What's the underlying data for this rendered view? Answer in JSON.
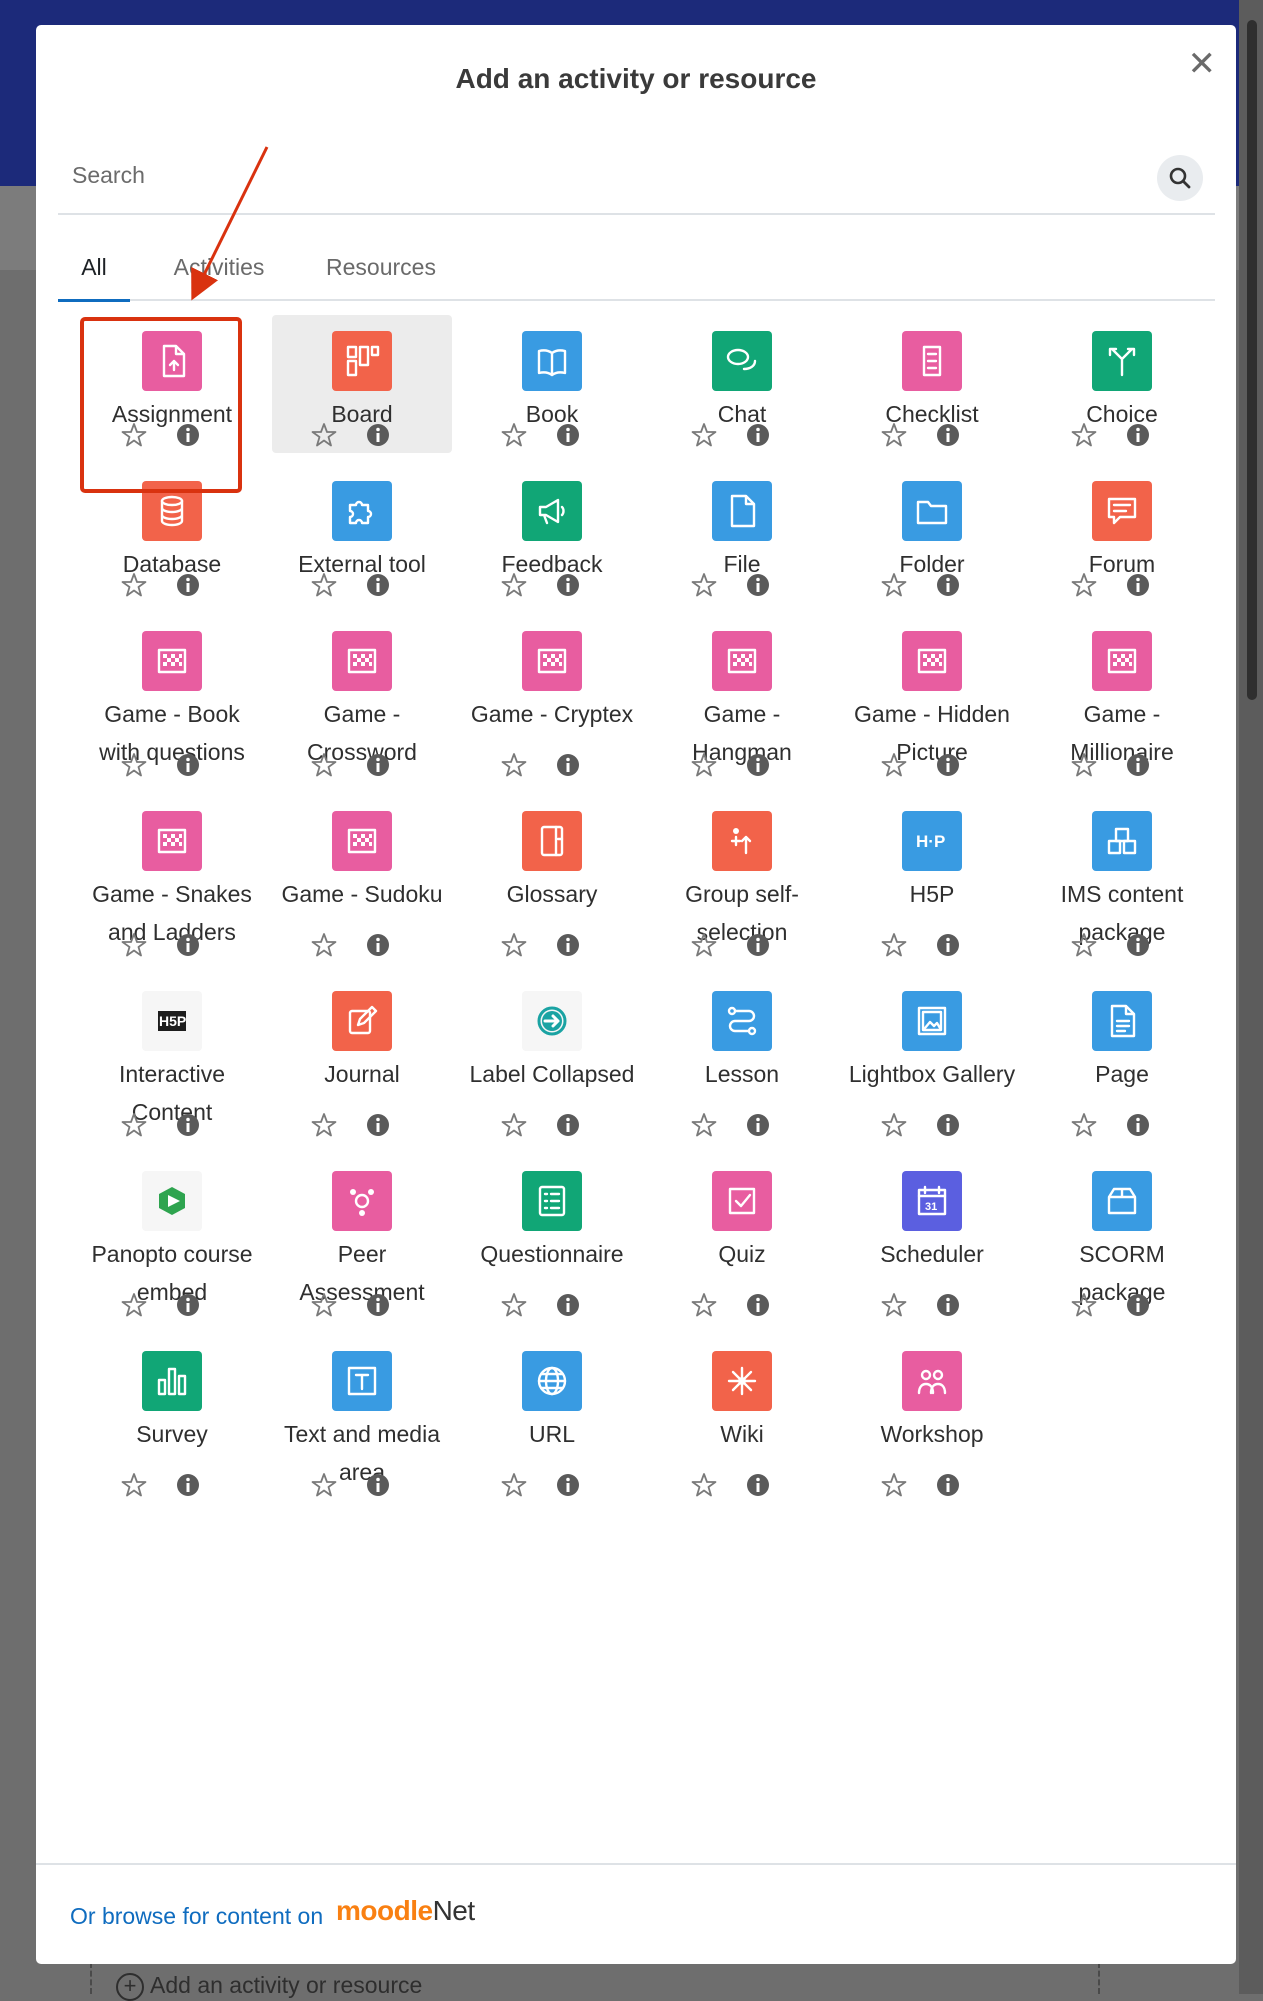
{
  "background": {
    "footer_link": "Add an activity or resource"
  },
  "modal": {
    "title": "Add an activity or resource",
    "close_icon": "close-icon",
    "search": {
      "placeholder": "Search",
      "value": ""
    },
    "tabs": [
      {
        "label": "All",
        "active": true
      },
      {
        "label": "Activities",
        "active": false
      },
      {
        "label": "Resources",
        "active": false
      }
    ],
    "items": [
      {
        "label": "Assignment",
        "icon": "assignment-icon",
        "color": "#e85da0"
      },
      {
        "label": "Board",
        "icon": "board-icon",
        "color": "#f2634a"
      },
      {
        "label": "Book",
        "icon": "book-icon",
        "color": "#399be2"
      },
      {
        "label": "Chat",
        "icon": "chat-icon",
        "color": "#11a676"
      },
      {
        "label": "Checklist",
        "icon": "checklist-icon",
        "color": "#e85da0"
      },
      {
        "label": "Choice",
        "icon": "choice-icon",
        "color": "#11a676"
      },
      {
        "label": "Database",
        "icon": "database-icon",
        "color": "#f2634a"
      },
      {
        "label": "External tool",
        "icon": "puzzle-icon",
        "color": "#399be2"
      },
      {
        "label": "Feedback",
        "icon": "megaphone-icon",
        "color": "#11a676"
      },
      {
        "label": "File",
        "icon": "file-icon",
        "color": "#399be2"
      },
      {
        "label": "Folder",
        "icon": "folder-icon",
        "color": "#399be2"
      },
      {
        "label": "Forum",
        "icon": "forum-icon",
        "color": "#f2634a"
      },
      {
        "label": "Game - Book with questions",
        "icon": "game-icon",
        "color": "#e85da0"
      },
      {
        "label": "Game - Crossword",
        "icon": "game-icon",
        "color": "#e85da0"
      },
      {
        "label": "Game - Cryptex",
        "icon": "game-icon",
        "color": "#e85da0"
      },
      {
        "label": "Game - Hangman",
        "icon": "game-icon",
        "color": "#e85da0"
      },
      {
        "label": "Game - Hidden Picture",
        "icon": "game-icon",
        "color": "#e85da0"
      },
      {
        "label": "Game - Millionaire",
        "icon": "game-icon",
        "color": "#e85da0"
      },
      {
        "label": "Game - Snakes and Ladders",
        "icon": "game-icon",
        "color": "#e85da0"
      },
      {
        "label": "Game - Sudoku",
        "icon": "game-icon",
        "color": "#e85da0"
      },
      {
        "label": "Glossary",
        "icon": "glossary-icon",
        "color": "#f2634a"
      },
      {
        "label": "Group self-selection",
        "icon": "group-icon",
        "color": "#f2634a"
      },
      {
        "label": "H5P",
        "icon": "h5p-icon",
        "color": "#399be2"
      },
      {
        "label": "IMS content package",
        "icon": "package-icon",
        "color": "#399be2"
      },
      {
        "label": "Interactive Content",
        "icon": "h5p-dark-icon",
        "color": "#1d1d1d"
      },
      {
        "label": "Journal",
        "icon": "journal-icon",
        "color": "#f2634a"
      },
      {
        "label": "Label Collapsed",
        "icon": "arrow-circle-icon",
        "color": "#1aa3a3"
      },
      {
        "label": "Lesson",
        "icon": "lesson-icon",
        "color": "#399be2"
      },
      {
        "label": "Lightbox Gallery",
        "icon": "gallery-icon",
        "color": "#399be2"
      },
      {
        "label": "Page",
        "icon": "page-icon",
        "color": "#399be2"
      },
      {
        "label": "Panopto course embed",
        "icon": "panopto-icon",
        "color": "#2ea44f"
      },
      {
        "label": "Peer Assessment",
        "icon": "peer-icon",
        "color": "#e85da0"
      },
      {
        "label": "Questionnaire",
        "icon": "questionnaire-icon",
        "color": "#11a676"
      },
      {
        "label": "Quiz",
        "icon": "quiz-icon",
        "color": "#e85da0"
      },
      {
        "label": "Scheduler",
        "icon": "calendar-icon",
        "color": "#5b5fe0"
      },
      {
        "label": "SCORM package",
        "icon": "scorm-icon",
        "color": "#399be2"
      },
      {
        "label": "Survey",
        "icon": "survey-icon",
        "color": "#11a676"
      },
      {
        "label": "Text and media area",
        "icon": "text-media-icon",
        "color": "#399be2"
      },
      {
        "label": "URL",
        "icon": "globe-icon",
        "color": "#399be2"
      },
      {
        "label": "Wiki",
        "icon": "wiki-icon",
        "color": "#f2634a"
      },
      {
        "label": "Workshop",
        "icon": "workshop-icon",
        "color": "#e85da0"
      }
    ],
    "footer": {
      "browse_text": "Or browse for content on",
      "moodlenet_brand": "moodle",
      "moodlenet_suffix": "Net"
    }
  }
}
